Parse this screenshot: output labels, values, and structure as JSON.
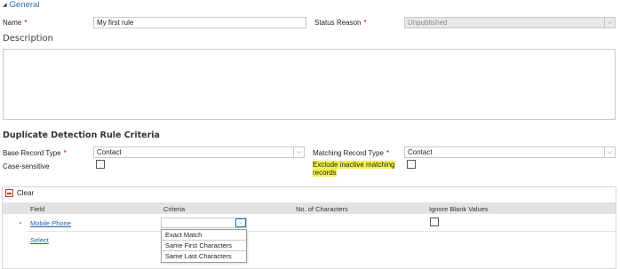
{
  "general": {
    "toggle_icon": "collapse-triangle-icon",
    "title": "General"
  },
  "fields": {
    "name_label": "Name",
    "name_value": "My first rule",
    "status_reason_label": "Status Reason",
    "status_reason_value": "Unpublished",
    "required_mark": "*"
  },
  "description": {
    "title": "Description",
    "value": ""
  },
  "criteria_section": {
    "title": "Duplicate Detection Rule Criteria",
    "base_record_type_label": "Base Record Type",
    "base_record_type_value": "Contact",
    "matching_record_type_label": "Matching Record Type",
    "matching_record_type_value": "Contact",
    "case_sensitive_label": "Case-sensitive",
    "case_sensitive_checked": false,
    "exclude_inactive_label_line1": "Exclude inactive matching",
    "exclude_inactive_label_line2": "records",
    "exclude_inactive_checked": false,
    "highlight_color": "#f3f34a"
  },
  "grid": {
    "clear_label": "Clear",
    "clear_icon": "clear-icon",
    "columns": [
      "Field",
      "Criteria",
      "No. of Characters",
      "Ignore Blank Values"
    ],
    "rows": [
      {
        "field": "Mobile Phone",
        "criteria": "",
        "characters": "",
        "ignore_blank": false
      }
    ],
    "select_link": "Select"
  },
  "criteria_dropdown": {
    "options": [
      "Exact Match",
      "Same First Characters",
      "Same Last Characters"
    ]
  },
  "colors": {
    "link": "#1a5fb4",
    "required": "#c40000",
    "disabled_bg": "#e9e9e9",
    "grid_header_bg": "#e3e3e3"
  }
}
